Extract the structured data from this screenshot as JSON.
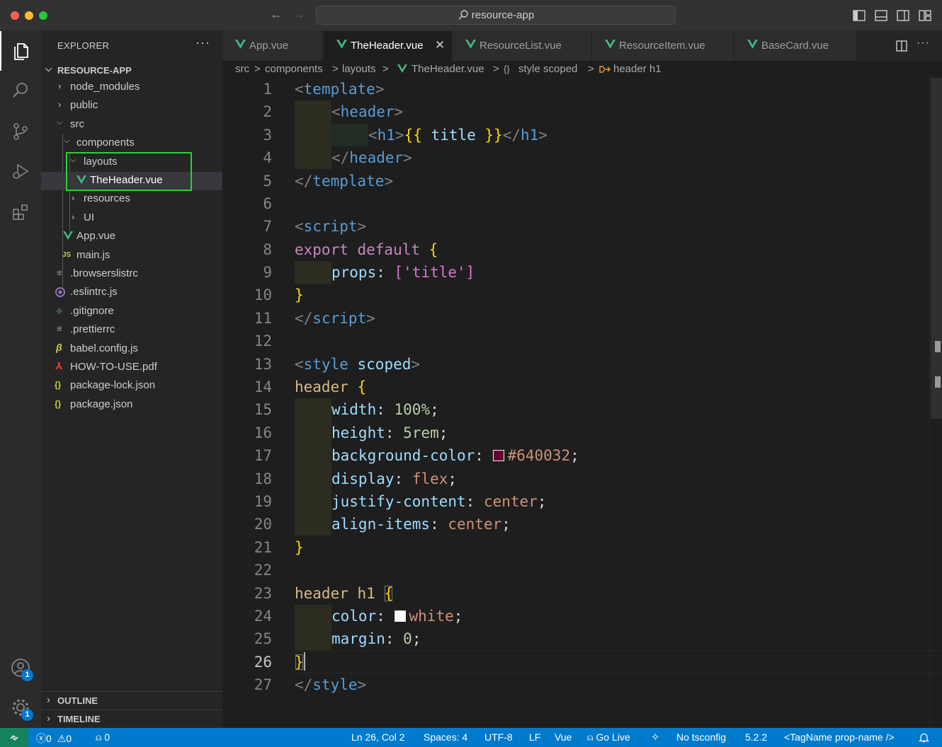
{
  "window": {
    "search_label": "resource-app"
  },
  "activity": {
    "accounts_badge": "1",
    "manage_badge": "1"
  },
  "explorer": {
    "title": "EXPLORER",
    "more": "···",
    "root": "RESOURCE-APP",
    "items": [
      {
        "label": "node_modules"
      },
      {
        "label": "public"
      },
      {
        "label": "src"
      },
      {
        "label": "components"
      },
      {
        "label": "layouts"
      },
      {
        "label": "TheHeader.vue"
      },
      {
        "label": "resources"
      },
      {
        "label": "UI"
      },
      {
        "label": "App.vue"
      },
      {
        "label": "main.js",
        "icon": "JS"
      },
      {
        "label": ".browserslistrc"
      },
      {
        "label": ".eslintrc.js"
      },
      {
        "label": ".gitignore"
      },
      {
        "label": ".prettierrc"
      },
      {
        "label": "babel.config.js"
      },
      {
        "label": "HOW-TO-USE.pdf"
      },
      {
        "label": "package-lock.json",
        "icon": "{}"
      },
      {
        "label": "package.json",
        "icon": "{}"
      }
    ],
    "outline": "OUTLINE",
    "timeline": "TIMELINE"
  },
  "tabs": [
    {
      "label": "App.vue"
    },
    {
      "label": "TheHeader.vue",
      "close": "✕"
    },
    {
      "label": "ResourceList.vue"
    },
    {
      "label": "ResourceItem.vue"
    },
    {
      "label": "BaseCard.vue"
    }
  ],
  "breadcrumbs": {
    "items": [
      "src",
      "components",
      "layouts",
      "TheHeader.vue",
      "style scoped",
      "header h1"
    ],
    "style_icon": "{}",
    "sep": ">"
  },
  "editor": {
    "line_numbers": [
      "1",
      "2",
      "3",
      "4",
      "5",
      "6",
      "7",
      "8",
      "9",
      "10",
      "11",
      "12",
      "13",
      "14",
      "15",
      "16",
      "17",
      "18",
      "19",
      "20",
      "21",
      "22",
      "23",
      "24",
      "25",
      "26",
      "27"
    ],
    "current_line": "26",
    "tokens": {
      "l1": [
        "<",
        "template",
        ">"
      ],
      "l2": [
        "<",
        "header",
        ">"
      ],
      "l3": [
        "<",
        "h1",
        ">",
        "{{ ",
        "title",
        " }}",
        "</",
        "h1",
        ">"
      ],
      "l4": [
        "</",
        "header",
        ">"
      ],
      "l5": [
        "</",
        "template",
        ">"
      ],
      "l7": [
        "<",
        "script",
        ">"
      ],
      "l8": [
        "export",
        " default ",
        "{"
      ],
      "l9": [
        "props",
        ": ",
        "['title']"
      ],
      "l10": [
        "}"
      ],
      "l11": [
        "</",
        "script",
        ">"
      ],
      "l13": [
        "<",
        "style",
        " scoped",
        ">"
      ],
      "l14": [
        "header ",
        "{"
      ],
      "l15": [
        "width",
        ": ",
        "100%",
        ";"
      ],
      "l16": [
        "height",
        ": ",
        "5rem",
        ";"
      ],
      "l17": [
        "background-color",
        ": ",
        "#640032",
        ";"
      ],
      "l18": [
        "display",
        ": ",
        "flex",
        ";"
      ],
      "l19": [
        "justify-content",
        ": ",
        "center",
        ";"
      ],
      "l20": [
        "align-items",
        ": ",
        "center",
        ";"
      ],
      "l21": [
        "}"
      ],
      "l23": [
        "header h1 ",
        "{"
      ],
      "l24": [
        "color",
        ": ",
        "white",
        ";"
      ],
      "l25": [
        "margin",
        ": ",
        "0",
        ";"
      ],
      "l26": [
        "}"
      ],
      "l27": [
        "</",
        "style",
        ">"
      ]
    },
    "swatches": {
      "bg": "#640032",
      "white": "#ffffff"
    }
  },
  "status": {
    "errors": "0",
    "warnings": "0",
    "ports": "0",
    "position": "Ln 26, Col 2",
    "spaces": "Spaces: 4",
    "encoding": "UTF-8",
    "eol": "LF",
    "language": "Vue",
    "golive": "Go Live",
    "tsconfig": "No tsconfig",
    "version": "5.2.2",
    "tagname": "<TagName prop-name />"
  },
  "colors": {
    "accent": "#007acc",
    "vue": "#41b883",
    "highlight_box": "#29d231"
  }
}
